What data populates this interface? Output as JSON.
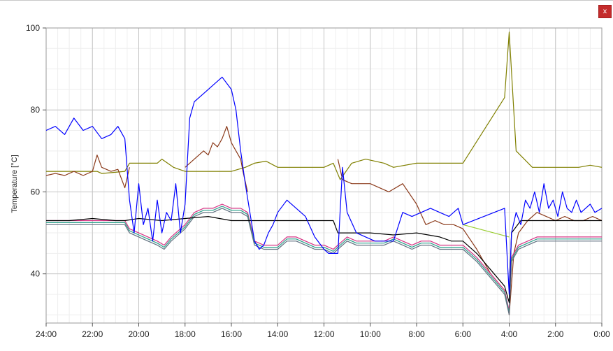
{
  "window": {
    "close_label": "x"
  },
  "chart_data": {
    "type": "line",
    "title": "",
    "xlabel": "",
    "ylabel": "Temperature [°C]",
    "ylim": [
      28,
      100
    ],
    "yticks": [
      40,
      60,
      80,
      100
    ],
    "xlim": [
      24,
      0
    ],
    "x_reversed": true,
    "xticks": [
      24,
      22,
      20,
      18,
      16,
      14,
      12,
      10,
      8,
      6,
      4,
      2,
      0
    ],
    "xtick_labels": [
      "24:00",
      "22:00",
      "20:00",
      "18:00",
      "16:00",
      "14:00",
      "12:00",
      "10:00",
      "8:00",
      "6:00",
      "4:00",
      "2:00",
      "0:00"
    ],
    "grid": true,
    "legend": "none",
    "series": [
      {
        "color": "#808000",
        "x": [
          24,
          21.8,
          21.6,
          20.6,
          20.4,
          19.2,
          19.0,
          18.5,
          18.0,
          16.0,
          15.4,
          15.0,
          14.5,
          14.0,
          12.0,
          11.6,
          11.3,
          10.8,
          10.2,
          9.4,
          9.0,
          8.0,
          6.0,
          4.2,
          4.0,
          3.7,
          3.0,
          2.0,
          1.0,
          0.5,
          0
        ],
        "y": [
          65,
          65,
          64.5,
          65,
          67,
          67,
          68,
          66,
          65,
          65,
          66,
          67,
          67.5,
          66,
          66,
          67,
          63,
          67,
          68,
          67,
          66,
          67,
          67,
          83,
          99,
          70,
          66,
          66,
          66,
          66.5,
          66
        ]
      },
      {
        "color": "#8b3a1a",
        "x": [
          24,
          23.6,
          23.2,
          22.8,
          22.4,
          22.0,
          21.8,
          21.6,
          21.2,
          20.9,
          20.6,
          20.4
        ],
        "y": [
          64,
          64.5,
          64,
          65,
          64,
          65,
          69,
          66,
          65,
          65.5,
          61,
          66
        ]
      },
      {
        "color": "#8b3a1a",
        "x": [
          18.0,
          17.6,
          17.2,
          17.0,
          16.8,
          16.6,
          16.4,
          16.2,
          16.0,
          15.8,
          15.6,
          15.5,
          15.3
        ],
        "y": [
          66,
          68,
          70,
          69,
          72,
          71,
          73,
          76,
          72,
          70,
          68,
          65,
          60
        ]
      },
      {
        "color": "#8b3a1a",
        "x": [
          11.4,
          11.2,
          10.8,
          10.4,
          10.0,
          9.6,
          9.2,
          8.6,
          8.0,
          7.6,
          7.2,
          6.8,
          6.4,
          6.0,
          5.4,
          4.8,
          4.2,
          4.0,
          3.8,
          3.6,
          3.2,
          2.8,
          2.4,
          2.0,
          1.6,
          1.2,
          0.8,
          0.4,
          0
        ],
        "y": [
          68,
          63,
          62,
          62,
          62,
          61,
          60,
          62,
          57,
          52,
          53,
          52,
          52,
          51,
          46,
          40,
          36,
          30,
          45,
          50,
          53,
          55,
          54,
          53,
          54,
          53,
          53,
          54,
          53
        ]
      },
      {
        "color": "#d63384",
        "x": [
          24,
          21,
          20.6,
          20.4,
          20.0,
          19.6,
          19.2,
          18.9,
          18.6,
          18.4,
          18.0,
          17.6,
          17.2,
          16.8,
          16.4,
          16.0,
          15.6,
          15.3,
          15.0,
          14.6,
          14.0,
          13.6,
          13.2,
          12.8,
          12.4,
          12.0,
          11.6,
          11.4,
          11.0,
          10.6,
          10.2,
          9.8,
          9.4,
          9.0,
          8.6,
          8.2,
          7.8,
          7.4,
          7.0,
          6.6,
          6.2,
          6.0,
          5.4,
          4.8,
          4.2,
          4.0,
          3.9,
          3.6,
          3.2,
          2.8,
          2.4,
          2.0,
          1.6,
          1.2,
          0.8,
          0.4,
          0
        ],
        "y": [
          53,
          53,
          53,
          51,
          50,
          49,
          48,
          47,
          49,
          50,
          52,
          55,
          56,
          56,
          57,
          56,
          56,
          55,
          48,
          47,
          47,
          49,
          49,
          48,
          47,
          47,
          46,
          47,
          49,
          48,
          48,
          48,
          48,
          49,
          48,
          47,
          48,
          48,
          47,
          47,
          47,
          47,
          44,
          40,
          36,
          31,
          44,
          47,
          48,
          49,
          49,
          49,
          49,
          49,
          49,
          49,
          49
        ]
      },
      {
        "color": "#2aa08a",
        "x": [
          24,
          21,
          20.6,
          20.4,
          20.0,
          19.6,
          19.2,
          18.9,
          18.6,
          18.4,
          18.0,
          17.6,
          17.2,
          16.8,
          16.4,
          16.0,
          15.6,
          15.3,
          15.0,
          14.6,
          14.0,
          13.6,
          13.2,
          12.8,
          12.4,
          12.0,
          11.6,
          11.4,
          11.0,
          10.6,
          10.2,
          9.8,
          9.4,
          9.0,
          8.6,
          8.2,
          7.8,
          7.4,
          7.0,
          6.6,
          6.2,
          6.0,
          5.4,
          4.8,
          4.2,
          4.0,
          3.9,
          3.6,
          3.2,
          2.8,
          2.4,
          2.0,
          1.6,
          1.2,
          0.8,
          0.4,
          0
        ],
        "y": [
          52.5,
          52.5,
          52.5,
          50.5,
          49.5,
          48.5,
          47.5,
          46.5,
          48.5,
          49.5,
          51.5,
          54.5,
          55.5,
          55.5,
          56.5,
          55.5,
          55.5,
          54.5,
          47.5,
          46.5,
          46.5,
          48.5,
          48.5,
          47.5,
          46.5,
          46.5,
          45.5,
          46.5,
          48.5,
          47.5,
          47.5,
          47.5,
          47.5,
          48.5,
          47.5,
          46.5,
          47.5,
          47.5,
          46.5,
          46.5,
          46.5,
          46.5,
          43.5,
          39.5,
          35.5,
          30.5,
          43.5,
          46.5,
          47.5,
          48.5,
          48.5,
          48.5,
          48.5,
          48.5,
          48.5,
          48.5,
          48.5
        ]
      },
      {
        "color": "#607080",
        "x": [
          24,
          21,
          20.6,
          20.4,
          20.0,
          19.6,
          19.2,
          18.9,
          18.6,
          18.4,
          18.0,
          17.6,
          17.2,
          16.8,
          16.4,
          16.0,
          15.6,
          15.3,
          15.0,
          14.6,
          14.0,
          13.6,
          13.2,
          12.8,
          12.4,
          12.0,
          11.6,
          11.4,
          11.0,
          10.6,
          10.2,
          9.8,
          9.4,
          9.0,
          8.6,
          8.2,
          7.8,
          7.4,
          7.0,
          6.6,
          6.2,
          6.0,
          5.4,
          4.8,
          4.2,
          4.0,
          3.9,
          3.6,
          3.2,
          2.8,
          2.4,
          2.0,
          1.6,
          1.2,
          0.8,
          0.4,
          0
        ],
        "y": [
          52,
          52,
          52,
          50,
          49,
          48,
          47,
          46,
          48,
          49,
          51,
          54,
          55,
          55,
          56,
          55,
          55,
          54,
          47,
          46,
          46,
          48,
          48,
          47,
          46,
          46,
          45,
          46,
          48,
          47,
          47,
          47,
          47,
          48,
          47,
          46,
          47,
          47,
          46,
          46,
          46,
          46,
          43,
          39,
          35,
          30,
          43,
          46,
          47,
          48,
          48,
          48,
          48,
          48,
          48,
          48,
          48
        ]
      },
      {
        "color": "#9acd32",
        "x": [
          6.0,
          4.0
        ],
        "y": [
          52,
          49
        ]
      },
      {
        "color": "#000000",
        "x": [
          24,
          23.0,
          22.0,
          21.0,
          20.6,
          20.0,
          19.0,
          18.0,
          17.0,
          16.0,
          15.5,
          15.0,
          14.0,
          13.0,
          12.0,
          11.6,
          11.4,
          11.0,
          10.0,
          9.0,
          8.0,
          7.0,
          6.5,
          6.0,
          5.4,
          4.8,
          4.2,
          4.0,
          3.9,
          3.5,
          3.0,
          2.0,
          1.0,
          0
        ],
        "y": [
          53,
          53,
          53.5,
          53,
          53,
          53.5,
          53,
          53.5,
          54,
          53,
          53,
          53,
          53,
          53,
          53,
          53,
          50,
          50,
          50,
          49.5,
          50,
          49,
          48,
          48,
          45,
          41,
          37,
          33,
          50,
          53,
          53,
          53,
          53,
          53
        ]
      },
      {
        "color": "#0000ff",
        "x": [
          24,
          23.6,
          23.2,
          22.8,
          22.4,
          22.0,
          21.6,
          21.2,
          20.9,
          20.6,
          20.4,
          20.2,
          20.0,
          19.8,
          19.6,
          19.4,
          19.2,
          19.0,
          18.8,
          18.6,
          18.4,
          18.2,
          18.0,
          17.8,
          17.6,
          17.2,
          16.8,
          16.4,
          16.0,
          15.8,
          15.6,
          15.4,
          15.2,
          15.0,
          14.8,
          14.6,
          14.4,
          14.2,
          14.0,
          13.6,
          13.2,
          12.8,
          12.4,
          12.0,
          11.8,
          11.6,
          11.4,
          11.2,
          11.0,
          10.6,
          10.2,
          9.8,
          9.4,
          9.0,
          8.6,
          8.2,
          7.8,
          7.4,
          7.0,
          6.6,
          6.2,
          6.0,
          4.2,
          4.0,
          3.9,
          3.7,
          3.5,
          3.3,
          3.1,
          2.9,
          2.7,
          2.5,
          2.3,
          2.1,
          1.9,
          1.7,
          1.5,
          1.3,
          1.1,
          0.9,
          0.7,
          0.5,
          0.3,
          0
        ],
        "y": [
          75,
          76,
          74,
          78,
          75,
          76,
          73,
          74,
          76,
          73,
          58,
          50,
          62,
          52,
          56,
          48,
          58,
          50,
          55,
          53,
          62,
          50,
          57,
          78,
          82,
          84,
          86,
          88,
          85,
          80,
          70,
          62,
          55,
          48,
          46,
          47,
          50,
          52,
          55,
          58,
          56,
          54,
          49,
          46,
          45,
          45,
          45,
          66,
          55,
          50,
          49,
          48,
          48,
          48,
          55,
          54,
          55,
          56,
          55,
          54,
          56,
          52,
          56,
          35,
          50,
          55,
          52,
          58,
          56,
          60,
          55,
          62,
          56,
          58,
          54,
          60,
          56,
          55,
          58,
          55,
          56,
          57,
          55,
          56
        ]
      }
    ]
  }
}
